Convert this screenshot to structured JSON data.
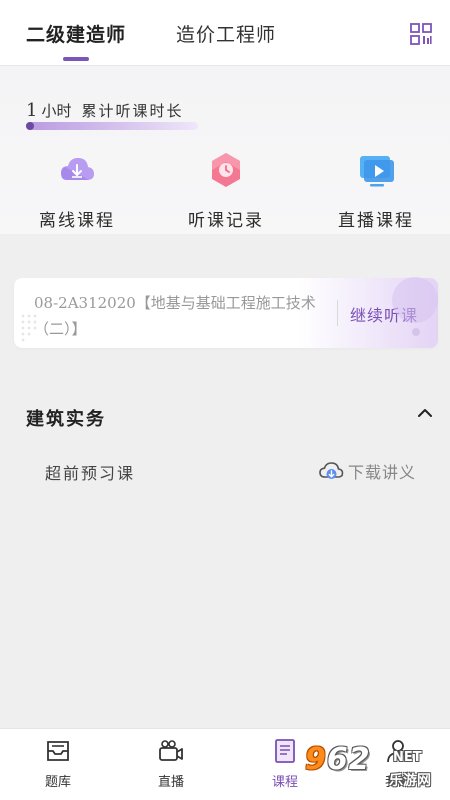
{
  "top_tabs": {
    "active": "二级建造师",
    "inactive": "造价工程师"
  },
  "summary": {
    "hours_value": "1",
    "hours_unit": "小时",
    "hours_label": "累计听课时长",
    "quick_actions": [
      {
        "label": "离线课程",
        "icon": "offline-download-icon",
        "color": "#a78bf0"
      },
      {
        "label": "听课记录",
        "icon": "clock-history-icon",
        "color": "#f26c8a"
      },
      {
        "label": "直播课程",
        "icon": "live-play-icon",
        "color": "#4aa3f0"
      }
    ]
  },
  "continue_card": {
    "title": "08-2A312020【地基与基础工程施工技术（二）】",
    "action": "继续听课"
  },
  "section": {
    "title": "建筑实务",
    "lesson": "超前预习课",
    "download_label": "下载讲义"
  },
  "bottom_nav": [
    {
      "label": "题库",
      "icon": "question-bank-icon"
    },
    {
      "label": "直播",
      "icon": "live-camera-icon"
    },
    {
      "label": "课程",
      "icon": "course-book-icon",
      "active": true
    },
    {
      "label": "我的",
      "icon": "profile-icon"
    }
  ],
  "watermark": {
    "logo_9": "9",
    "logo_rest": "62",
    "net": "NET",
    "sub": "乐游网"
  },
  "colors": {
    "accent": "#7b4fb6",
    "background": "#efefef"
  }
}
